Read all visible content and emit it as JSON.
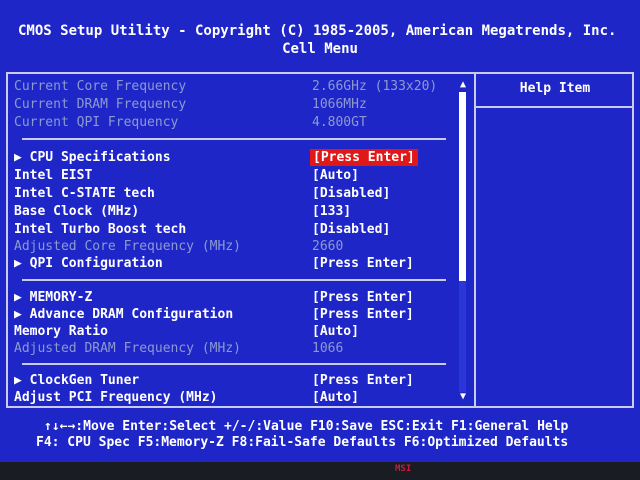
{
  "header": {
    "title": "CMOS Setup Utility - Copyright (C) 1985-2005, American Megatrends, Inc.",
    "menu": "Cell Menu"
  },
  "help": {
    "title": "Help Item"
  },
  "rows": [
    {
      "label": "Current Core Frequency",
      "value": "2.66GHz (133x20)"
    },
    {
      "label": "Current DRAM Frequency",
      "value": "1066MHz"
    },
    {
      "label": "Current QPI Frequency",
      "value": "4.800GT"
    },
    {
      "label": "▶ CPU Specifications",
      "value": "[Press Enter]"
    },
    {
      "label": "Intel EIST",
      "value": "[Auto]"
    },
    {
      "label": "Intel C-STATE tech",
      "value": "[Disabled]"
    },
    {
      "label": "Base Clock (MHz)",
      "value": "[133]"
    },
    {
      "label": "Intel Turbo Boost tech",
      "value": "[Disabled]"
    },
    {
      "label": "Adjusted Core Frequency (MHz)",
      "value": "2660"
    },
    {
      "label": "▶ QPI Configuration",
      "value": "[Press Enter]"
    },
    {
      "label": "▶ MEMORY-Z",
      "value": "[Press Enter]"
    },
    {
      "label": "▶ Advance DRAM Configuration",
      "value": "[Press Enter]"
    },
    {
      "label": "Memory Ratio",
      "value": "[Auto]"
    },
    {
      "label": "Adjusted DRAM Frequency (MHz)",
      "value": "1066"
    },
    {
      "label": "▶ ClockGen Tuner",
      "value": "[Press Enter]"
    },
    {
      "label": "Adjust PCI Frequency (MHz)",
      "value": "[Auto]"
    }
  ],
  "scrollbar": {
    "up": "▲",
    "down": "▼",
    "position": 0.0,
    "visible_fraction": 0.63
  },
  "footer": {
    "line1": "↑↓←→:Move  Enter:Select  +/-/:Value  F10:Save  ESC:Exit  F1:General Help",
    "line2": "F4: CPU Spec  F5:Memory-Z  F8:Fail-Safe Defaults  F6:Optimized Defaults"
  },
  "colors": {
    "background": "#1f26c8",
    "selected_value": "#e01818",
    "disabled_text": "#8c9ad0",
    "text": "#ffffff"
  },
  "bezel": {
    "logo": "MSI"
  }
}
